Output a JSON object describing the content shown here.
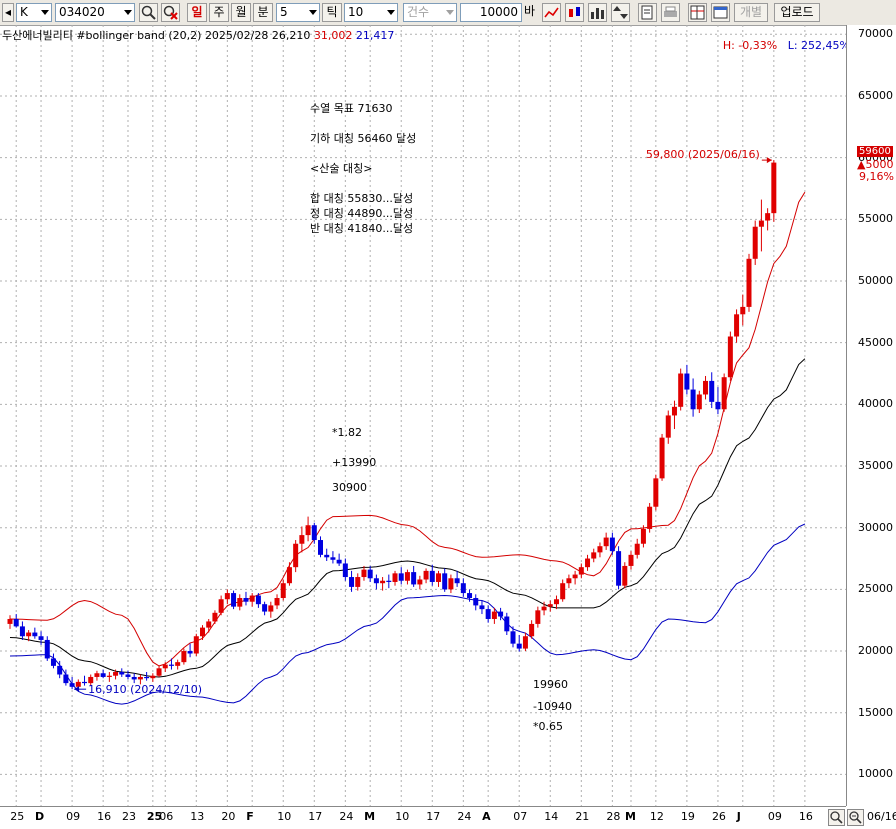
{
  "toolbar": {
    "period_type": "K",
    "code": "034020",
    "tabs": [
      "일",
      "주",
      "월",
      "분"
    ],
    "active_tab": "일",
    "minute_value": "5",
    "tick_label": "틱",
    "tick_value": "10",
    "count_label": "건수",
    "count_value": "10000",
    "bar_label": "바",
    "disabled_label": "개별",
    "upload_label": "업로드",
    "icons": [
      "search-icon",
      "reset-icon",
      "line-chart-icon",
      "candle-chart-icon",
      "bar-chart-icon",
      "updown-icon",
      "page-icon",
      "print-icon",
      "grid-icon",
      "window-icon"
    ]
  },
  "info": {
    "name": "두산에너빌리티 #bollinger band",
    "params": "(20,2)",
    "date": "2025/02/28",
    "close": "26,210",
    "upper": "31,002",
    "lower": "21,417",
    "high_pct": "H: -0,33%",
    "low_pct": "L: 252,45%"
  },
  "annotations": {
    "wave": [
      "수열 목표 71630",
      "기하 대칭 56460 달성",
      "<산술 대칭>",
      "합 대칭 55830...달성",
      "정 대칭 44890...달성",
      "반 대칭 41840...달성"
    ],
    "up": [
      "*1.82",
      "+13990",
      "30900"
    ],
    "down": [
      "19960",
      "-10940",
      "*0.65"
    ],
    "max_label": "59,800 (2025/06/16)",
    "min_label": "16,910 (2024/12/10)"
  },
  "price_tag": {
    "price": "59600",
    "change": "▲5000",
    "pct": "9,16%"
  },
  "chart_data": {
    "type": "candlestick",
    "title": "두산에너빌리티 #bollinger band (20,2)",
    "y_ticks": [
      10000,
      15000,
      20000,
      25000,
      30000,
      35000,
      40000,
      45000,
      50000,
      55000,
      60000,
      65000,
      70000
    ],
    "ylim": [
      7500,
      70500
    ],
    "x_tick_labels": [
      {
        "label": "25",
        "i": 1
      },
      {
        "label": "D",
        "i": 5
      },
      {
        "label": "09",
        "i": 10
      },
      {
        "label": "16",
        "i": 15
      },
      {
        "label": "23",
        "i": 19
      },
      {
        "label": "25",
        "i": 23
      },
      {
        "label": "06",
        "i": 25
      },
      {
        "label": "13",
        "i": 30
      },
      {
        "label": "20",
        "i": 35
      },
      {
        "label": "F",
        "i": 39
      },
      {
        "label": "10",
        "i": 44
      },
      {
        "label": "17",
        "i": 49
      },
      {
        "label": "24",
        "i": 54
      },
      {
        "label": "M",
        "i": 58
      },
      {
        "label": "10",
        "i": 63
      },
      {
        "label": "17",
        "i": 68
      },
      {
        "label": "24",
        "i": 73
      },
      {
        "label": "A",
        "i": 77
      },
      {
        "label": "07",
        "i": 82
      },
      {
        "label": "14",
        "i": 87
      },
      {
        "label": "21",
        "i": 92
      },
      {
        "label": "28",
        "i": 97
      },
      {
        "label": "M",
        "i": 100
      },
      {
        "label": "12",
        "i": 104
      },
      {
        "label": "19",
        "i": 109
      },
      {
        "label": "26",
        "i": 114
      },
      {
        "label": "J",
        "i": 118
      },
      {
        "label": "09",
        "i": 123
      },
      {
        "label": "16",
        "i": 128
      }
    ],
    "x_end_label": "06/16",
    "candles_ohlc": [
      [
        22200,
        22900,
        21800,
        22600
      ],
      [
        22600,
        23000,
        21900,
        22000
      ],
      [
        22000,
        22400,
        20900,
        21200
      ],
      [
        21200,
        21700,
        20800,
        21500
      ],
      [
        21500,
        21900,
        21000,
        21200
      ],
      [
        21200,
        21600,
        20500,
        20900
      ],
      [
        20900,
        21200,
        19200,
        19400
      ],
      [
        19400,
        19800,
        18600,
        18800
      ],
      [
        18800,
        19200,
        17800,
        18100
      ],
      [
        18100,
        18500,
        17200,
        17400
      ],
      [
        17400,
        17900,
        16910,
        17100
      ],
      [
        17100,
        17700,
        16950,
        17500
      ],
      [
        17500,
        18000,
        17200,
        17400
      ],
      [
        17400,
        18100,
        17200,
        17900
      ],
      [
        17900,
        18400,
        17600,
        18200
      ],
      [
        18200,
        18500,
        17800,
        17900
      ],
      [
        17900,
        18300,
        17500,
        18000
      ],
      [
        18000,
        18500,
        17700,
        18300
      ],
      [
        18300,
        18600,
        17900,
        18100
      ],
      [
        18100,
        18400,
        17700,
        17900
      ],
      [
        17900,
        18200,
        17400,
        17700
      ],
      [
        17700,
        18100,
        17300,
        17900
      ],
      [
        17900,
        18300,
        17600,
        17800
      ],
      [
        17800,
        18200,
        17500,
        18000
      ],
      [
        18000,
        18800,
        17900,
        18600
      ],
      [
        18600,
        19100,
        18300,
        18900
      ],
      [
        18900,
        19400,
        18500,
        18800
      ],
      [
        18800,
        19300,
        18500,
        19100
      ],
      [
        19100,
        20200,
        18900,
        20000
      ],
      [
        20000,
        20600,
        19500,
        19800
      ],
      [
        19800,
        21400,
        19600,
        21200
      ],
      [
        21200,
        22100,
        20900,
        21900
      ],
      [
        21900,
        22600,
        21500,
        22400
      ],
      [
        22400,
        23300,
        22200,
        23100
      ],
      [
        23100,
        24500,
        22900,
        24200
      ],
      [
        24200,
        25000,
        23800,
        24700
      ],
      [
        24700,
        24900,
        23400,
        23600
      ],
      [
        23600,
        24600,
        23300,
        24300
      ],
      [
        24300,
        24800,
        23700,
        24000
      ],
      [
        24000,
        24700,
        23600,
        24500
      ],
      [
        24500,
        24700,
        23500,
        23800
      ],
      [
        23800,
        24000,
        22900,
        23200
      ],
      [
        23200,
        24000,
        22700,
        23700
      ],
      [
        23700,
        24600,
        23400,
        24300
      ],
      [
        24300,
        25800,
        24100,
        25500
      ],
      [
        25500,
        27200,
        25300,
        26800
      ],
      [
        26800,
        29000,
        26400,
        28700
      ],
      [
        28700,
        30100,
        28000,
        29400
      ],
      [
        29400,
        30900,
        28900,
        30200
      ],
      [
        30200,
        30400,
        28700,
        29000
      ],
      [
        29000,
        29300,
        27600,
        27800
      ],
      [
        27800,
        28300,
        27300,
        27600
      ],
      [
        27600,
        28100,
        27100,
        27400
      ],
      [
        27400,
        27900,
        26900,
        27100
      ],
      [
        27100,
        27500,
        25700,
        26000
      ],
      [
        26000,
        26500,
        24800,
        25200
      ],
      [
        25200,
        26300,
        24900,
        26000
      ],
      [
        26000,
        26900,
        25700,
        26600
      ],
      [
        26600,
        26900,
        25600,
        25900
      ],
      [
        25900,
        26200,
        25000,
        25500
      ],
      [
        25500,
        26000,
        24900,
        25700
      ],
      [
        25700,
        26200,
        25100,
        25600
      ],
      [
        25600,
        26500,
        25300,
        26300
      ],
      [
        26300,
        26800,
        25400,
        25700
      ],
      [
        25700,
        26600,
        25400,
        26400
      ],
      [
        26400,
        26900,
        25200,
        25400
      ],
      [
        25400,
        26100,
        25000,
        25800
      ],
      [
        25800,
        26700,
        25500,
        26500
      ],
      [
        26500,
        27000,
        25300,
        25600
      ],
      [
        25600,
        26500,
        25200,
        26300
      ],
      [
        26300,
        26700,
        24800,
        25000
      ],
      [
        25000,
        26200,
        24700,
        25900
      ],
      [
        25900,
        26500,
        25200,
        25500
      ],
      [
        25500,
        25900,
        24400,
        24700
      ],
      [
        24700,
        25000,
        24000,
        24300
      ],
      [
        24300,
        24600,
        23300,
        23700
      ],
      [
        23700,
        24100,
        23000,
        23400
      ],
      [
        23400,
        23700,
        22300,
        22600
      ],
      [
        22600,
        23500,
        22200,
        23200
      ],
      [
        23200,
        23500,
        22500,
        22800
      ],
      [
        22800,
        23100,
        21300,
        21600
      ],
      [
        21600,
        22000,
        20300,
        20600
      ],
      [
        20600,
        21300,
        19960,
        20200
      ],
      [
        20200,
        21500,
        20000,
        21200
      ],
      [
        21200,
        22500,
        21000,
        22200
      ],
      [
        22200,
        23600,
        21900,
        23300
      ],
      [
        23300,
        24000,
        22900,
        23600
      ],
      [
        23600,
        24100,
        23200,
        23800
      ],
      [
        23800,
        24500,
        23400,
        24200
      ],
      [
        24200,
        25800,
        24000,
        25500
      ],
      [
        25500,
        26200,
        25100,
        25900
      ],
      [
        25900,
        26500,
        25400,
        26200
      ],
      [
        26200,
        27100,
        25900,
        26800
      ],
      [
        26800,
        27800,
        26500,
        27500
      ],
      [
        27500,
        28300,
        27200,
        28000
      ],
      [
        28000,
        28800,
        27600,
        28500
      ],
      [
        28500,
        29600,
        28200,
        29200
      ],
      [
        29200,
        29600,
        27800,
        28100
      ],
      [
        28100,
        28500,
        25000,
        25300
      ],
      [
        25300,
        27200,
        25100,
        26900
      ],
      [
        26900,
        28100,
        26600,
        27800
      ],
      [
        27800,
        29100,
        27500,
        28700
      ],
      [
        28700,
        30200,
        28400,
        29900
      ],
      [
        29900,
        32000,
        29600,
        31700
      ],
      [
        31700,
        34300,
        31400,
        34000
      ],
      [
        34000,
        37600,
        33800,
        37300
      ],
      [
        37300,
        39500,
        36800,
        39100
      ],
      [
        39100,
        40300,
        38000,
        39800
      ],
      [
        39800,
        42900,
        39500,
        42500
      ],
      [
        42500,
        43200,
        40800,
        41200
      ],
      [
        41200,
        42100,
        39000,
        39600
      ],
      [
        39600,
        41100,
        39300,
        40800
      ],
      [
        40800,
        42300,
        40400,
        41900
      ],
      [
        41900,
        42600,
        39700,
        40200
      ],
      [
        40200,
        41400,
        39200,
        39600
      ],
      [
        39600,
        42500,
        39400,
        42200
      ],
      [
        42200,
        45900,
        41900,
        45500
      ],
      [
        45500,
        47700,
        45000,
        47300
      ],
      [
        47300,
        48900,
        46400,
        47900
      ],
      [
        47900,
        52200,
        47500,
        51800
      ],
      [
        51800,
        54900,
        51300,
        54400
      ],
      [
        54400,
        56600,
        52400,
        54900
      ],
      [
        54900,
        55900,
        54100,
        55500
      ],
      [
        55500,
        59800,
        54800,
        59600
      ]
    ],
    "up_color": "#e00000",
    "down_color": "#0000e0",
    "bands": {
      "upper_color": "#d40000",
      "middle_color": "#000000",
      "lower_color": "#0000c0",
      "upper": [
        [
          0,
          22600
        ],
        [
          6,
          22500
        ],
        [
          12,
          24100
        ],
        [
          18,
          22900
        ],
        [
          24,
          18800
        ],
        [
          30,
          20800
        ],
        [
          36,
          23900
        ],
        [
          42,
          24800
        ],
        [
          47,
          28100
        ],
        [
          52,
          30900
        ],
        [
          58,
          31000
        ],
        [
          64,
          30200
        ],
        [
          70,
          28400
        ],
        [
          76,
          27600
        ],
        [
          82,
          27800
        ],
        [
          88,
          27300
        ],
        [
          94,
          26100
        ],
        [
          100,
          29900
        ],
        [
          106,
          30200
        ],
        [
          112,
          35400
        ],
        [
          118,
          44000
        ],
        [
          124,
          52000
        ],
        [
          128,
          57200
        ]
      ],
      "middle": [
        [
          0,
          21100
        ],
        [
          6,
          20700
        ],
        [
          12,
          19200
        ],
        [
          18,
          18300
        ],
        [
          24,
          17900
        ],
        [
          30,
          18600
        ],
        [
          36,
          20600
        ],
        [
          42,
          22400
        ],
        [
          47,
          24400
        ],
        [
          52,
          26500
        ],
        [
          58,
          26800
        ],
        [
          64,
          27300
        ],
        [
          70,
          26700
        ],
        [
          76,
          25800
        ],
        [
          82,
          24600
        ],
        [
          88,
          23500
        ],
        [
          94,
          23500
        ],
        [
          100,
          25300
        ],
        [
          106,
          28100
        ],
        [
          112,
          32200
        ],
        [
          118,
          37000
        ],
        [
          124,
          40700
        ],
        [
          128,
          43700
        ]
      ],
      "lower": [
        [
          0,
          19600
        ],
        [
          6,
          19700
        ],
        [
          12,
          16500
        ],
        [
          18,
          15700
        ],
        [
          24,
          16700
        ],
        [
          30,
          16300
        ],
        [
          36,
          15800
        ],
        [
          42,
          17900
        ],
        [
          47,
          19800
        ],
        [
          52,
          20600
        ],
        [
          58,
          22100
        ],
        [
          64,
          24300
        ],
        [
          70,
          24500
        ],
        [
          76,
          24100
        ],
        [
          82,
          21600
        ],
        [
          88,
          19700
        ],
        [
          94,
          20100
        ],
        [
          100,
          19300
        ],
        [
          106,
          22600
        ],
        [
          112,
          22300
        ],
        [
          118,
          25700
        ],
        [
          124,
          28800
        ],
        [
          128,
          30300
        ]
      ]
    }
  }
}
